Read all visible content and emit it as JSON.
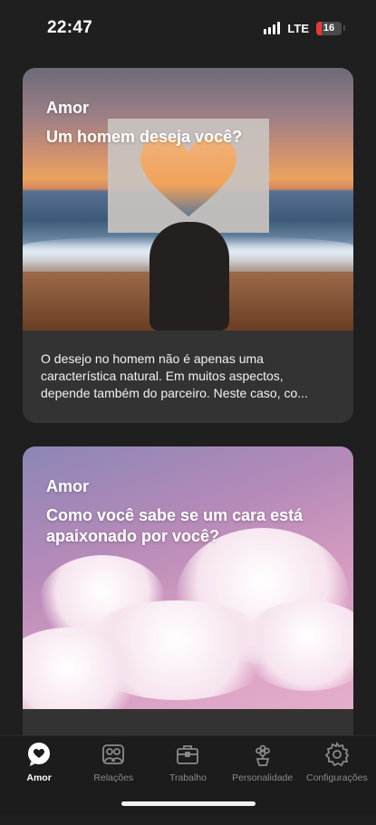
{
  "status_bar": {
    "time": "22:47",
    "network": "LTE",
    "battery_level": "16",
    "battery_color": "#e53935"
  },
  "feed": {
    "cards": [
      {
        "category": "Amor",
        "title": "Um homem deseja você?",
        "excerpt": "O desejo no homem não é apenas uma característica natural. Em muitos aspectos, depende também do parceiro. Neste caso, co...",
        "image": "sunset-heart-paper-photo"
      },
      {
        "category": "Amor",
        "title": "Como você sabe se um cara está apaixonado por você?",
        "excerpt": "",
        "image": "pink-clouds-sky-photo"
      }
    ]
  },
  "tab_bar": {
    "active_color": "#ffffff",
    "inactive_color": "#8a8a8a",
    "tabs": [
      {
        "label": "Amor",
        "icon": "heart-chat-icon",
        "active": true
      },
      {
        "label": "Relações",
        "icon": "people-icon",
        "active": false
      },
      {
        "label": "Trabalho",
        "icon": "briefcase-icon",
        "active": false
      },
      {
        "label": "Personalidade",
        "icon": "flower-pot-icon",
        "active": false
      },
      {
        "label": "Configurações",
        "icon": "gear-icon",
        "active": false
      }
    ]
  }
}
